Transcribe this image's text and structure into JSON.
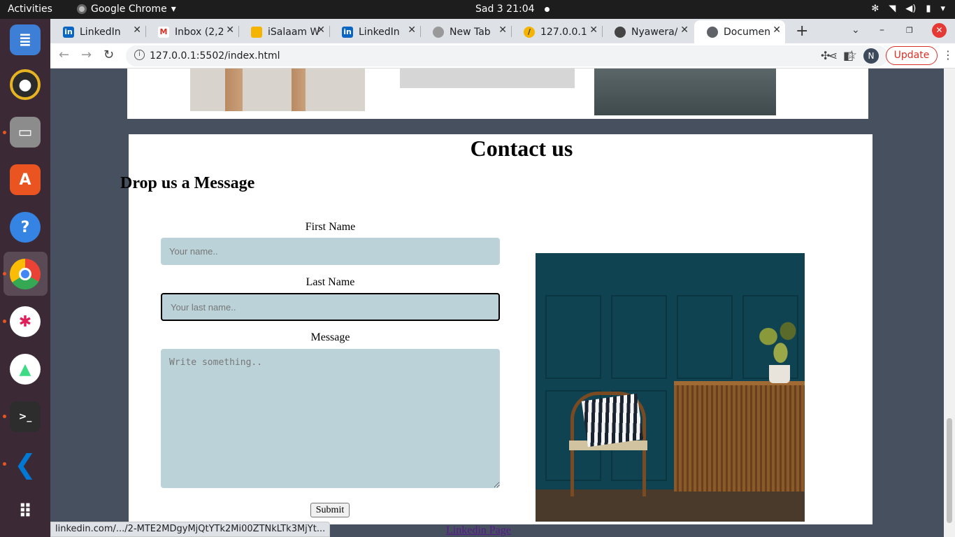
{
  "os_bar": {
    "activities": "Activities",
    "app_name": "Google Chrome",
    "clock": "Sad 3  21:04"
  },
  "tabs": [
    {
      "label": "LinkedIn",
      "favicon": "linkedin-icon",
      "color": "#0a66c2",
      "glyph": "in"
    },
    {
      "label": "Inbox (2,2",
      "favicon": "gmail-icon",
      "color": "#d93025",
      "glyph": "M"
    },
    {
      "label": "iSalaam W",
      "favicon": "slides-icon",
      "color": "#f4b400",
      "glyph": ""
    },
    {
      "label": "LinkedIn",
      "favicon": "linkedin-icon",
      "color": "#0a66c2",
      "glyph": "in"
    },
    {
      "label": "New Tab",
      "favicon": "github-icon",
      "color": "#888888",
      "glyph": ""
    },
    {
      "label": "127.0.0.1:",
      "favicon": "liveserver-icon",
      "color": "#f4b400",
      "glyph": "//"
    },
    {
      "label": "Nyawera/",
      "favicon": "github-icon",
      "color": "#444444",
      "glyph": ""
    },
    {
      "label": "Documen",
      "favicon": "globe-icon",
      "color": "#5f6368",
      "glyph": ""
    }
  ],
  "toolbar": {
    "url": "127.0.0.1:5502/index.html",
    "profile_initial": "N",
    "update_label": "Update"
  },
  "page": {
    "contact_title": "Contact us",
    "subtitle": "Drop us a Message",
    "first_name_label": "First Name",
    "first_name_placeholder": "Your name..",
    "last_name_label": "Last Name",
    "last_name_placeholder": "Your last name..",
    "message_label": "Message",
    "message_placeholder": "Write something..",
    "submit_label": "Submit",
    "footer_link": "Linkedin Page"
  },
  "status_bar_url": "linkedin.com/.../2-MTE2MDgyMjQtYTk2Mi00ZTNkLTk3MjYt...",
  "colors": {
    "input_bg": "#bbd3d8",
    "page_bg": "#47505e",
    "update_red": "#d93025"
  }
}
